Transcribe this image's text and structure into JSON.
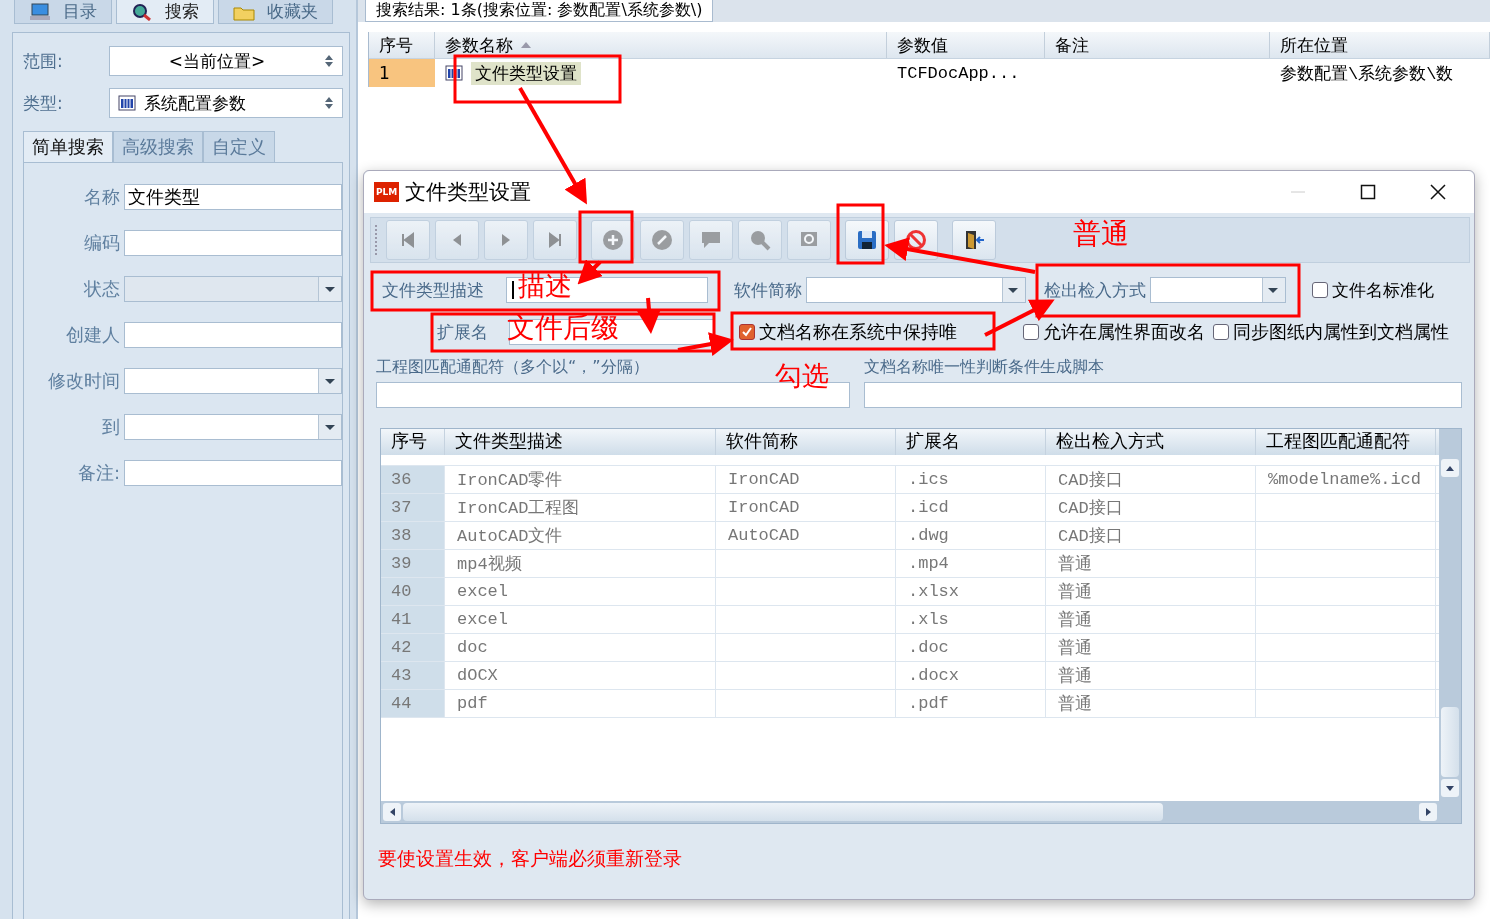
{
  "top_tabs": [
    {
      "label": "目录",
      "selected": false,
      "kind": "monitor"
    },
    {
      "label": "搜索",
      "selected": true,
      "kind": "search"
    },
    {
      "label": "收藏夹",
      "selected": false,
      "kind": "folder"
    }
  ],
  "scope": {
    "label": "范围:",
    "value": "<当前位置>"
  },
  "type": {
    "label": "类型:",
    "value": "系统配置参数"
  },
  "search_tabs": [
    {
      "label": "简单搜索",
      "selected": true
    },
    {
      "label": "高级搜索",
      "selected": false
    },
    {
      "label": "自定义",
      "selected": false
    }
  ],
  "search_fields": [
    {
      "label": "名称",
      "value": "文件类型",
      "kind": "text"
    },
    {
      "label": "编码",
      "kind": "text"
    },
    {
      "label": "状态",
      "kind": "dropdown",
      "disabled": true
    },
    {
      "label": "创建人",
      "kind": "text"
    },
    {
      "label": "修改时间",
      "kind": "dropdown",
      "disabled": false
    },
    {
      "label": "到",
      "kind": "dropdown",
      "disabled": false
    },
    {
      "label": "备注:",
      "kind": "text"
    }
  ],
  "results": {
    "tab": "搜索结果: 1条(搜索位置: 参数配置\\系统参数\\)",
    "columns": [
      "序号",
      "参数名称",
      "参数值",
      "备注",
      "所在位置"
    ],
    "rows": [
      {
        "cells": [
          "1",
          "文件类型设置",
          "TCFDocApp...",
          "",
          "参数配置\\系统参数\\数"
        ],
        "selected": true
      }
    ]
  },
  "dialog": {
    "logo": "PLM",
    "title": "文件类型设置",
    "toolbar": [
      {
        "kind": "first",
        "disabled": true
      },
      {
        "kind": "prev",
        "disabled": true
      },
      {
        "kind": "next",
        "disabled": true
      },
      {
        "kind": "last",
        "disabled": true
      },
      {
        "kind": "add",
        "disabled": true
      },
      {
        "kind": "edit",
        "disabled": true
      },
      {
        "kind": "comment",
        "disabled": true
      },
      {
        "kind": "find",
        "disabled": true
      },
      {
        "kind": "refresh",
        "disabled": true
      },
      {
        "kind": "save",
        "disabled": false
      },
      {
        "kind": "cancel",
        "disabled": false
      },
      {
        "kind": "exit",
        "disabled": false
      }
    ],
    "desc_label": "文件类型描述",
    "software_label": "软件简称",
    "checkout_label": "检出检入方式",
    "ext_label": "扩展名",
    "checks": [
      {
        "label": "文件名标准化",
        "checked": false
      },
      {
        "label": "文档名称在系统中保持唯",
        "checked": true
      },
      {
        "label": "允许在属性界面改名",
        "checked": false
      },
      {
        "label": "同步图纸内属性到文档属性",
        "checked": false
      }
    ],
    "wildcard_label": "工程图匹配通配符（多个以“，”分隔）",
    "script_label": "文档名称唯一性判断条件生成脚本",
    "table": {
      "columns": [
        "序号",
        "文件类型描述",
        "软件简称",
        "扩展名",
        "检出检入方式",
        "工程图匹配通配符"
      ],
      "rows": [
        [
          "36",
          "IronCAD零件",
          "IronCAD",
          ".ics",
          "CAD接口",
          "%modelname%.icd"
        ],
        [
          "37",
          "IronCAD工程图",
          "IronCAD",
          ".icd",
          "CAD接口",
          ""
        ],
        [
          "38",
          "AutoCAD文件",
          "AutoCAD",
          ".dwg",
          "CAD接口",
          ""
        ],
        [
          "39",
          "mp4视频",
          "",
          ".mp4",
          "普通",
          ""
        ],
        [
          "40",
          "excel",
          "",
          ".xlsx",
          "普通",
          ""
        ],
        [
          "41",
          "excel",
          "",
          ".xls",
          "普通",
          ""
        ],
        [
          "42",
          "doc",
          "",
          ".doc",
          "普通",
          ""
        ],
        [
          "43",
          "dOCX",
          "",
          ".docx",
          "普通",
          ""
        ],
        [
          "44",
          "pdf",
          "",
          ".pdf",
          "普通",
          ""
        ]
      ]
    },
    "footer": "要使设置生效，客户端必须重新登录"
  },
  "annotations": [
    "普通",
    "描述",
    "文件后缀",
    "勾选"
  ]
}
